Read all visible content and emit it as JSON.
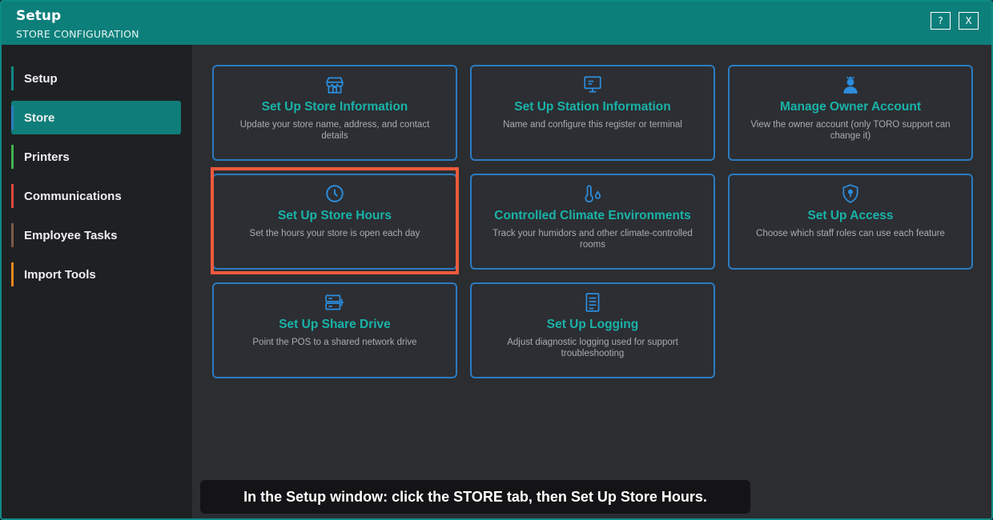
{
  "window": {
    "title": "Setup",
    "subtitle": "STORE CONFIGURATION",
    "help_label": "?",
    "close_label": "X"
  },
  "sidebar": {
    "items": [
      {
        "label": "Setup",
        "accent": "#0f8a85",
        "active": false
      },
      {
        "label": "Store",
        "accent": "#2c7bc0",
        "active": true
      },
      {
        "label": "Printers",
        "accent": "#3fb34f",
        "active": false
      },
      {
        "label": "Communications",
        "accent": "#e0483c",
        "active": false
      },
      {
        "label": "Employee Tasks",
        "accent": "#7a5a4a",
        "active": false
      },
      {
        "label": "Import Tools",
        "accent": "#f08a1c",
        "active": false
      }
    ]
  },
  "cards": [
    {
      "icon": "storefront-icon",
      "title": "Set Up Store Information",
      "desc": "Update your store name, address, and contact details"
    },
    {
      "icon": "monitor-icon",
      "title": "Set Up Station Information",
      "desc": "Name and configure this register or terminal"
    },
    {
      "icon": "owner-user-icon",
      "title": "Manage Owner Account",
      "desc": "View the owner account (only TORO support can change it)"
    },
    {
      "icon": "clock-icon",
      "title": "Set Up Store Hours",
      "desc": "Set the hours your store is open each day"
    },
    {
      "icon": "thermometer-drop-icon",
      "title": "Controlled Climate Environments",
      "desc": "Track your humidors and other climate-controlled rooms"
    },
    {
      "icon": "shield-lock-icon",
      "title": "Set Up Access",
      "desc": "Choose which staff roles can use each feature"
    },
    {
      "icon": "network-drive-icon",
      "title": "Set Up Share Drive",
      "desc": "Point the POS to a shared network drive"
    },
    {
      "icon": "document-log-icon",
      "title": "Set Up Logging",
      "desc": "Adjust diagnostic logging used for support troubleshooting"
    }
  ],
  "colors": {
    "header": "#0d7f7b",
    "card_border": "#2c7bc0",
    "card_title": "#19b3a8",
    "highlight": "#ef5a3c"
  },
  "caption": "In the Setup window: click the STORE tab, then Set Up Store Hours."
}
